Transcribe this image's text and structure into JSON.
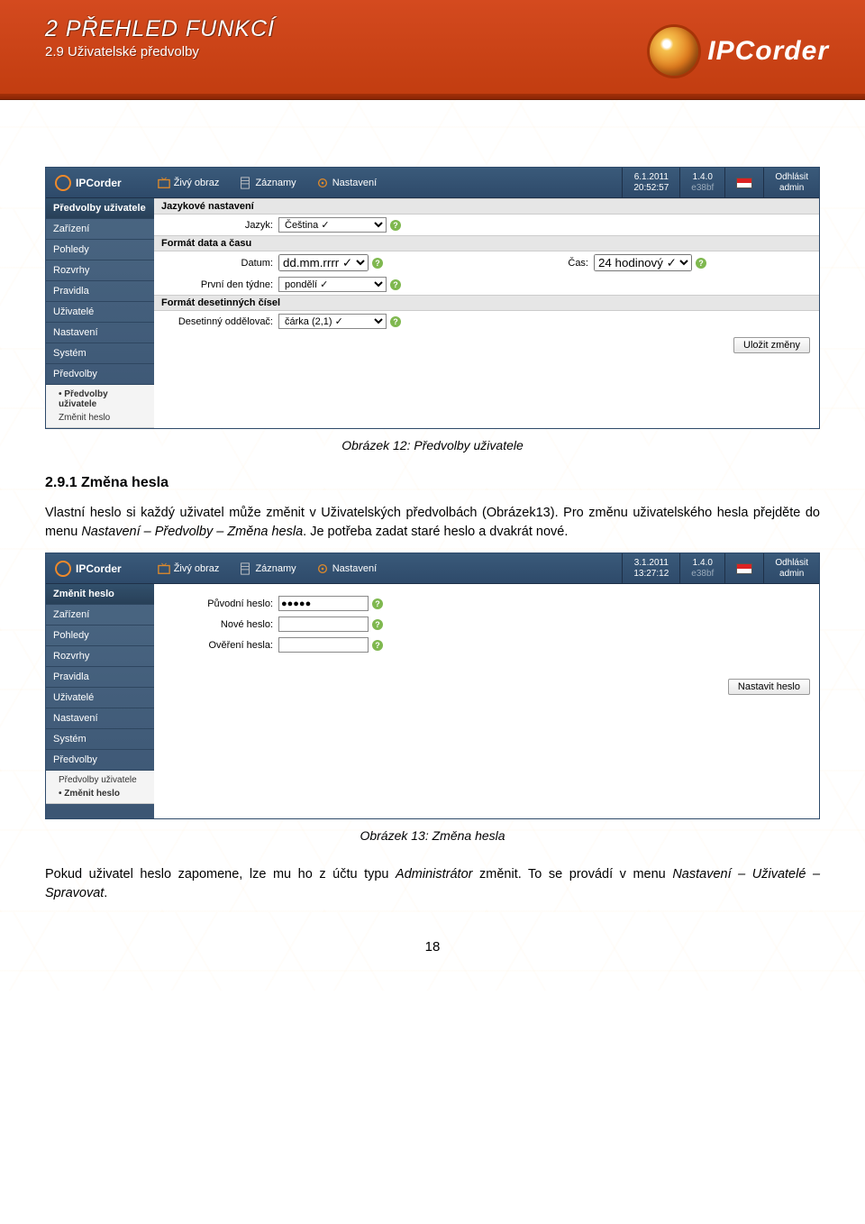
{
  "doc_header": {
    "chapter": "2   PŘEHLED FUNKCÍ",
    "section": "2.9 Uživatelské předvolby",
    "brand": "IPCorder"
  },
  "screenshot1": {
    "brand": "IPCorder",
    "tabs": {
      "live": "Živý obraz",
      "records": "Záznamy",
      "settings": "Nastavení"
    },
    "datetime": {
      "date": "6.1.2011",
      "time": "20:52:57"
    },
    "version": {
      "v": "1.4.0",
      "hash": "e38bf"
    },
    "logout": {
      "label": "Odhlásit",
      "user": "admin"
    },
    "sidebar": {
      "head": "Předvolby uživatele",
      "items": [
        "Zařízení",
        "Pohledy",
        "Rozvrhy",
        "Pravidla",
        "Uživatelé",
        "Nastavení",
        "Systém",
        "Předvolby"
      ],
      "subtree": {
        "a": "Předvolby uživatele",
        "b": "Změnit heslo"
      }
    },
    "sec1": {
      "title": "Jazykové nastavení",
      "lang_label": "Jazyk:",
      "lang_value": "Čeština ✓"
    },
    "sec2": {
      "title": "Formát data a času",
      "date_label": "Datum:",
      "date_value": "dd.mm.rrrr ✓",
      "weekday_label": "První den týdne:",
      "weekday_value": "pondělí ✓",
      "time_label": "Čas:",
      "time_value": "24 hodinový ✓"
    },
    "sec3": {
      "title": "Formát desetinných čísel",
      "sep_label": "Desetinný oddělovač:",
      "sep_value": "čárka (2,1) ✓"
    },
    "save": "Uložit změny"
  },
  "caption1": "Obrázek 12: Předvolby uživatele",
  "body": {
    "h": "2.9.1    Změna hesla",
    "p1a": "Vlastní heslo si každý uživatel může změnit v Uživatelských předvolbách (Obrázek13). Pro změnu uživatelského hesla přejděte do menu ",
    "p1b": "Nastavení – Předvolby – Změna hesla",
    "p1c": ". Je potřeba zadat staré heslo a dvakrát nové."
  },
  "screenshot2": {
    "brand": "IPCorder",
    "tabs": {
      "live": "Živý obraz",
      "records": "Záznamy",
      "settings": "Nastavení"
    },
    "datetime": {
      "date": "3.1.2011",
      "time": "13:27:12"
    },
    "version": {
      "v": "1.4.0",
      "hash": "e38bf"
    },
    "logout": {
      "label": "Odhlásit",
      "user": "admin"
    },
    "sidebar": {
      "head": "Změnit heslo",
      "items": [
        "Zařízení",
        "Pohledy",
        "Rozvrhy",
        "Pravidla",
        "Uživatelé",
        "Nastavení",
        "Systém",
        "Předvolby"
      ],
      "subtree": {
        "a": "Předvolby uživatele",
        "b": "Změnit heslo"
      }
    },
    "form": {
      "old_label": "Původní heslo:",
      "old_value": "●●●●●",
      "new_label": "Nové heslo:",
      "confirm_label": "Ověření hesla:"
    },
    "save": "Nastavit heslo"
  },
  "caption2": "Obrázek 13: Změna hesla",
  "body2": {
    "p1a": "Pokud uživatel heslo zapomene, lze mu ho z účtu typu ",
    "p1b": "Administrátor",
    "p1c": " změnit. To se provádí v menu ",
    "p1d": "Nastavení – Uživatelé – Spravovat",
    "p1e": "."
  },
  "pagenum": "18"
}
